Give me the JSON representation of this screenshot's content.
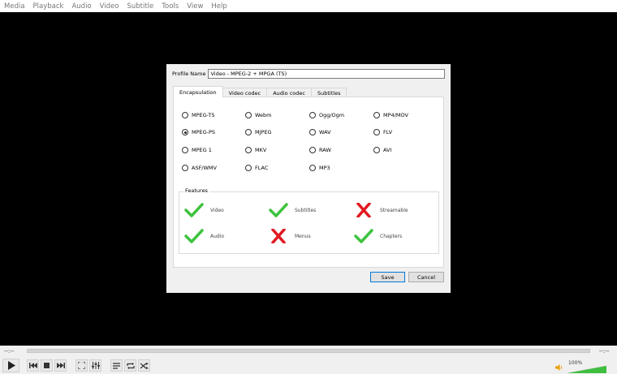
{
  "menu": [
    "Media",
    "Playback",
    "Audio",
    "Video",
    "Subtitle",
    "Tools",
    "View",
    "Help"
  ],
  "dialog": {
    "profile_label": "Profile Name",
    "profile_value": "Video - MPEG-2 + MPGA (TS)",
    "tabs": [
      "Encapsulation",
      "Video codec",
      "Audio codec",
      "Subtitles"
    ],
    "active_tab": "Encapsulation",
    "formats": [
      {
        "label": "MPEG-TS",
        "checked": false
      },
      {
        "label": "Webm",
        "checked": false
      },
      {
        "label": "Ogg/Ogm",
        "checked": false
      },
      {
        "label": "MP4/MOV",
        "checked": false
      },
      {
        "label": "MPEG-PS",
        "checked": true
      },
      {
        "label": "MJPEG",
        "checked": false
      },
      {
        "label": "WAV",
        "checked": false
      },
      {
        "label": "FLV",
        "checked": false
      },
      {
        "label": "MPEG 1",
        "checked": false
      },
      {
        "label": "MKV",
        "checked": false
      },
      {
        "label": "RAW",
        "checked": false
      },
      {
        "label": "AVI",
        "checked": false
      },
      {
        "label": "ASF/WMV",
        "checked": false
      },
      {
        "label": "FLAC",
        "checked": false
      },
      {
        "label": "MP3",
        "checked": false
      }
    ],
    "features_title": "Features",
    "features": [
      {
        "label": "Video",
        "supported": true
      },
      {
        "label": "Subtitles",
        "supported": true
      },
      {
        "label": "Streamable",
        "supported": false
      },
      {
        "label": "Audio",
        "supported": true
      },
      {
        "label": "Menus",
        "supported": false
      },
      {
        "label": "Chapters",
        "supported": true
      }
    ],
    "save_label": "Save",
    "cancel_label": "Cancel"
  },
  "player": {
    "time_elapsed": "--:--",
    "time_total": "--:--",
    "volume_label": "100%",
    "volume_level": 1.0
  },
  "colors": {
    "check": "#3ec33e",
    "cross": "#e0191f",
    "volume": "#3fbf3f"
  }
}
